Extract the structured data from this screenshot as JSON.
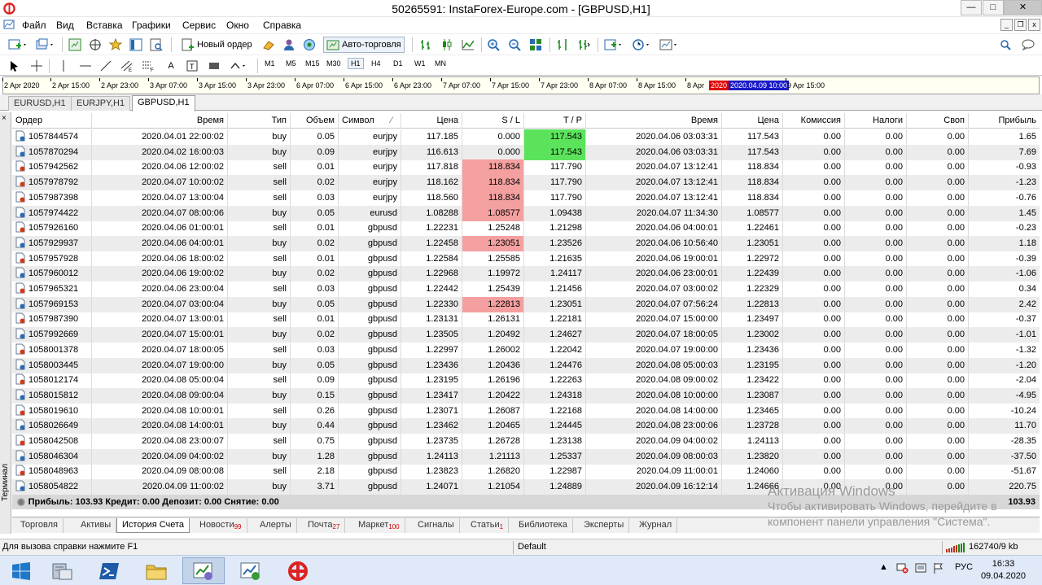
{
  "window": {
    "title": "50265591: InstaForex-Europe.com - [GBPUSD,H1]"
  },
  "menu": [
    "Файл",
    "Вид",
    "Вставка",
    "Графики",
    "Сервис",
    "Окно",
    "Справка"
  ],
  "toolbar": {
    "new_order": "Новый ордер",
    "auto_trading": "Авто-торговля",
    "timeframes": [
      "M1",
      "M5",
      "M15",
      "M30",
      "H1",
      "H4",
      "D1",
      "W1",
      "MN"
    ],
    "active_timeframe": "H1"
  },
  "time_axis": {
    "ticks": [
      "2 Apr 2020",
      "2 Apr 15:00",
      "2 Apr 23:00",
      "3 Apr 07:00",
      "3 Apr 15:00",
      "3 Apr 23:00",
      "6 Apr 07:00",
      "6 Apr 15:00",
      "6 Apr 23:00",
      "7 Apr 07:00",
      "7 Apr 15:00",
      "7 Apr 23:00",
      "8 Apr 07:00",
      "8 Apr 15:00",
      "8 Apr",
      "9 Apr 15:00"
    ],
    "crosshair_year": "2020",
    "crosshair_date": "2020.04.09 10:00"
  },
  "chart_tabs": [
    "EURUSD,H1",
    "EURJPY,H1",
    "GBPUSD,H1"
  ],
  "active_chart_tab": "GBPUSD,H1",
  "history": {
    "columns": [
      "Ордер",
      "Время",
      "Тип",
      "Объем",
      "Символ",
      "Цена",
      "S / L",
      "T / P",
      "Время",
      "Цена",
      "Комиссия",
      "Налоги",
      "Своп",
      "Прибыль"
    ],
    "rows": [
      {
        "order": "1057844574",
        "open_time": "2020.04.01 22:00:02",
        "type": "buy",
        "volume": "0.05",
        "symbol": "eurjpy",
        "price": "117.185",
        "sl": "0.000",
        "tp": "117.543",
        "close_time": "2020.04.06 03:03:31",
        "close_price": "117.543",
        "commission": "0.00",
        "taxes": "0.00",
        "swap": "0.00",
        "profit": "1.65",
        "hit": "tp"
      },
      {
        "order": "1057870294",
        "open_time": "2020.04.02 16:00:03",
        "type": "buy",
        "volume": "0.09",
        "symbol": "eurjpy",
        "price": "116.613",
        "sl": "0.000",
        "tp": "117.543",
        "close_time": "2020.04.06 03:03:31",
        "close_price": "117.543",
        "commission": "0.00",
        "taxes": "0.00",
        "swap": "0.00",
        "profit": "7.69",
        "hit": "tp"
      },
      {
        "order": "1057942562",
        "open_time": "2020.04.06 12:00:02",
        "type": "sell",
        "volume": "0.01",
        "symbol": "eurjpy",
        "price": "117.818",
        "sl": "118.834",
        "tp": "117.790",
        "close_time": "2020.04.07 13:12:41",
        "close_price": "118.834",
        "commission": "0.00",
        "taxes": "0.00",
        "swap": "0.00",
        "profit": "-0.93",
        "hit": "sl"
      },
      {
        "order": "1057978792",
        "open_time": "2020.04.07 10:00:02",
        "type": "sell",
        "volume": "0.02",
        "symbol": "eurjpy",
        "price": "118.162",
        "sl": "118.834",
        "tp": "117.790",
        "close_time": "2020.04.07 13:12:41",
        "close_price": "118.834",
        "commission": "0.00",
        "taxes": "0.00",
        "swap": "0.00",
        "profit": "-1.23",
        "hit": "sl"
      },
      {
        "order": "1057987398",
        "open_time": "2020.04.07 13:00:04",
        "type": "sell",
        "volume": "0.03",
        "symbol": "eurjpy",
        "price": "118.560",
        "sl": "118.834",
        "tp": "117.790",
        "close_time": "2020.04.07 13:12:41",
        "close_price": "118.834",
        "commission": "0.00",
        "taxes": "0.00",
        "swap": "0.00",
        "profit": "-0.76",
        "hit": "sl"
      },
      {
        "order": "1057974422",
        "open_time": "2020.04.07 08:00:06",
        "type": "buy",
        "volume": "0.05",
        "symbol": "eurusd",
        "price": "1.08288",
        "sl": "1.08577",
        "tp": "1.09438",
        "close_time": "2020.04.07 11:34:30",
        "close_price": "1.08577",
        "commission": "0.00",
        "taxes": "0.00",
        "swap": "0.00",
        "profit": "1.45",
        "hit": "sl"
      },
      {
        "order": "1057926160",
        "open_time": "2020.04.06 01:00:01",
        "type": "sell",
        "volume": "0.01",
        "symbol": "gbpusd",
        "price": "1.22231",
        "sl": "1.25248",
        "tp": "1.21298",
        "close_time": "2020.04.06 04:00:01",
        "close_price": "1.22461",
        "commission": "0.00",
        "taxes": "0.00",
        "swap": "0.00",
        "profit": "-0.23",
        "hit": ""
      },
      {
        "order": "1057929937",
        "open_time": "2020.04.06 04:00:01",
        "type": "buy",
        "volume": "0.02",
        "symbol": "gbpusd",
        "price": "1.22458",
        "sl": "1.23051",
        "tp": "1.23526",
        "close_time": "2020.04.06 10:56:40",
        "close_price": "1.23051",
        "commission": "0.00",
        "taxes": "0.00",
        "swap": "0.00",
        "profit": "1.18",
        "hit": "sl"
      },
      {
        "order": "1057957928",
        "open_time": "2020.04.06 18:00:02",
        "type": "sell",
        "volume": "0.01",
        "symbol": "gbpusd",
        "price": "1.22584",
        "sl": "1.25585",
        "tp": "1.21635",
        "close_time": "2020.04.06 19:00:01",
        "close_price": "1.22972",
        "commission": "0.00",
        "taxes": "0.00",
        "swap": "0.00",
        "profit": "-0.39",
        "hit": ""
      },
      {
        "order": "1057960012",
        "open_time": "2020.04.06 19:00:02",
        "type": "buy",
        "volume": "0.02",
        "symbol": "gbpusd",
        "price": "1.22968",
        "sl": "1.19972",
        "tp": "1.24117",
        "close_time": "2020.04.06 23:00:01",
        "close_price": "1.22439",
        "commission": "0.00",
        "taxes": "0.00",
        "swap": "0.00",
        "profit": "-1.06",
        "hit": ""
      },
      {
        "order": "1057965321",
        "open_time": "2020.04.06 23:00:04",
        "type": "sell",
        "volume": "0.03",
        "symbol": "gbpusd",
        "price": "1.22442",
        "sl": "1.25439",
        "tp": "1.21456",
        "close_time": "2020.04.07 03:00:02",
        "close_price": "1.22329",
        "commission": "0.00",
        "taxes": "0.00",
        "swap": "0.00",
        "profit": "0.34",
        "hit": ""
      },
      {
        "order": "1057969153",
        "open_time": "2020.04.07 03:00:04",
        "type": "buy",
        "volume": "0.05",
        "symbol": "gbpusd",
        "price": "1.22330",
        "sl": "1.22813",
        "tp": "1.23051",
        "close_time": "2020.04.07 07:56:24",
        "close_price": "1.22813",
        "commission": "0.00",
        "taxes": "0.00",
        "swap": "0.00",
        "profit": "2.42",
        "hit": "sl"
      },
      {
        "order": "1057987390",
        "open_time": "2020.04.07 13:00:01",
        "type": "sell",
        "volume": "0.01",
        "symbol": "gbpusd",
        "price": "1.23131",
        "sl": "1.26131",
        "tp": "1.22181",
        "close_time": "2020.04.07 15:00:00",
        "close_price": "1.23497",
        "commission": "0.00",
        "taxes": "0.00",
        "swap": "0.00",
        "profit": "-0.37",
        "hit": ""
      },
      {
        "order": "1057992669",
        "open_time": "2020.04.07 15:00:01",
        "type": "buy",
        "volume": "0.02",
        "symbol": "gbpusd",
        "price": "1.23505",
        "sl": "1.20492",
        "tp": "1.24627",
        "close_time": "2020.04.07 18:00:05",
        "close_price": "1.23002",
        "commission": "0.00",
        "taxes": "0.00",
        "swap": "0.00",
        "profit": "-1.01",
        "hit": ""
      },
      {
        "order": "1058001378",
        "open_time": "2020.04.07 18:00:05",
        "type": "sell",
        "volume": "0.03",
        "symbol": "gbpusd",
        "price": "1.22997",
        "sl": "1.26002",
        "tp": "1.22042",
        "close_time": "2020.04.07 19:00:00",
        "close_price": "1.23436",
        "commission": "0.00",
        "taxes": "0.00",
        "swap": "0.00",
        "profit": "-1.32",
        "hit": ""
      },
      {
        "order": "1058003445",
        "open_time": "2020.04.07 19:00:00",
        "type": "buy",
        "volume": "0.05",
        "symbol": "gbpusd",
        "price": "1.23436",
        "sl": "1.20436",
        "tp": "1.24476",
        "close_time": "2020.04.08 05:00:03",
        "close_price": "1.23195",
        "commission": "0.00",
        "taxes": "0.00",
        "swap": "0.00",
        "profit": "-1.20",
        "hit": ""
      },
      {
        "order": "1058012174",
        "open_time": "2020.04.08 05:00:04",
        "type": "sell",
        "volume": "0.09",
        "symbol": "gbpusd",
        "price": "1.23195",
        "sl": "1.26196",
        "tp": "1.22263",
        "close_time": "2020.04.08 09:00:02",
        "close_price": "1.23422",
        "commission": "0.00",
        "taxes": "0.00",
        "swap": "0.00",
        "profit": "-2.04",
        "hit": ""
      },
      {
        "order": "1058015812",
        "open_time": "2020.04.08 09:00:04",
        "type": "buy",
        "volume": "0.15",
        "symbol": "gbpusd",
        "price": "1.23417",
        "sl": "1.20422",
        "tp": "1.24318",
        "close_time": "2020.04.08 10:00:00",
        "close_price": "1.23087",
        "commission": "0.00",
        "taxes": "0.00",
        "swap": "0.00",
        "profit": "-4.95",
        "hit": ""
      },
      {
        "order": "1058019610",
        "open_time": "2020.04.08 10:00:01",
        "type": "sell",
        "volume": "0.26",
        "symbol": "gbpusd",
        "price": "1.23071",
        "sl": "1.26087",
        "tp": "1.22168",
        "close_time": "2020.04.08 14:00:00",
        "close_price": "1.23465",
        "commission": "0.00",
        "taxes": "0.00",
        "swap": "0.00",
        "profit": "-10.24",
        "hit": ""
      },
      {
        "order": "1058026649",
        "open_time": "2020.04.08 14:00:01",
        "type": "buy",
        "volume": "0.44",
        "symbol": "gbpusd",
        "price": "1.23462",
        "sl": "1.20465",
        "tp": "1.24445",
        "close_time": "2020.04.08 23:00:06",
        "close_price": "1.23728",
        "commission": "0.00",
        "taxes": "0.00",
        "swap": "0.00",
        "profit": "11.70",
        "hit": ""
      },
      {
        "order": "1058042508",
        "open_time": "2020.04.08 23:00:07",
        "type": "sell",
        "volume": "0.75",
        "symbol": "gbpusd",
        "price": "1.23735",
        "sl": "1.26728",
        "tp": "1.23138",
        "close_time": "2020.04.09 04:00:02",
        "close_price": "1.24113",
        "commission": "0.00",
        "taxes": "0.00",
        "swap": "0.00",
        "profit": "-28.35",
        "hit": ""
      },
      {
        "order": "1058046304",
        "open_time": "2020.04.09 04:00:02",
        "type": "buy",
        "volume": "1.28",
        "symbol": "gbpusd",
        "price": "1.24113",
        "sl": "1.21113",
        "tp": "1.25337",
        "close_time": "2020.04.09 08:00:03",
        "close_price": "1.23820",
        "commission": "0.00",
        "taxes": "0.00",
        "swap": "0.00",
        "profit": "-37.50",
        "hit": ""
      },
      {
        "order": "1058048963",
        "open_time": "2020.04.09 08:00:08",
        "type": "sell",
        "volume": "2.18",
        "symbol": "gbpusd",
        "price": "1.23823",
        "sl": "1.26820",
        "tp": "1.22987",
        "close_time": "2020.04.09 11:00:01",
        "close_price": "1.24060",
        "commission": "0.00",
        "taxes": "0.00",
        "swap": "0.00",
        "profit": "-51.67",
        "hit": ""
      },
      {
        "order": "1058054822",
        "open_time": "2020.04.09 11:00:02",
        "type": "buy",
        "volume": "3.71",
        "symbol": "gbpusd",
        "price": "1.24071",
        "sl": "1.21054",
        "tp": "1.24889",
        "close_time": "2020.04.09 16:12:14",
        "close_price": "1.24666",
        "commission": "0.00",
        "taxes": "0.00",
        "swap": "0.00",
        "profit": "220.75",
        "hit": ""
      }
    ],
    "summary": "Прибыль: 103.93  Кредит: 0.00  Депозит: 0.00  Снятие: 0.00",
    "summary_total": "103.93"
  },
  "terminal": {
    "side_label": "Терминал",
    "tabs": [
      {
        "label": "Торговля",
        "badge": ""
      },
      {
        "label": "Активы",
        "badge": ""
      },
      {
        "label": "История Счета",
        "badge": ""
      },
      {
        "label": "Новости",
        "badge": "99"
      },
      {
        "label": "Алерты",
        "badge": ""
      },
      {
        "label": "Почта",
        "badge": "27"
      },
      {
        "label": "Маркет",
        "badge": "100"
      },
      {
        "label": "Сигналы",
        "badge": ""
      },
      {
        "label": "Статьи",
        "badge": "1"
      },
      {
        "label": "Библиотека",
        "badge": ""
      },
      {
        "label": "Эксперты",
        "badge": ""
      },
      {
        "label": "Журнал",
        "badge": ""
      }
    ],
    "active_tab": "История Счета"
  },
  "watermark": {
    "line1": "Активация Windows",
    "line2": "Чтобы активировать Windows, перейдите в",
    "line3": "компонент панели управления \"Система\"."
  },
  "statusbar": {
    "help": "Для вызова справки нажмите F1",
    "profile": "Default",
    "traffic": "162740/9 kb"
  },
  "taskbar": {
    "lang": "РУС",
    "time": "16:33",
    "date": "09.04.2020"
  },
  "colors": {
    "sl_hit": "#f4a0a0",
    "tp_hit": "#5ce35c",
    "alt_row": "#ececec"
  }
}
